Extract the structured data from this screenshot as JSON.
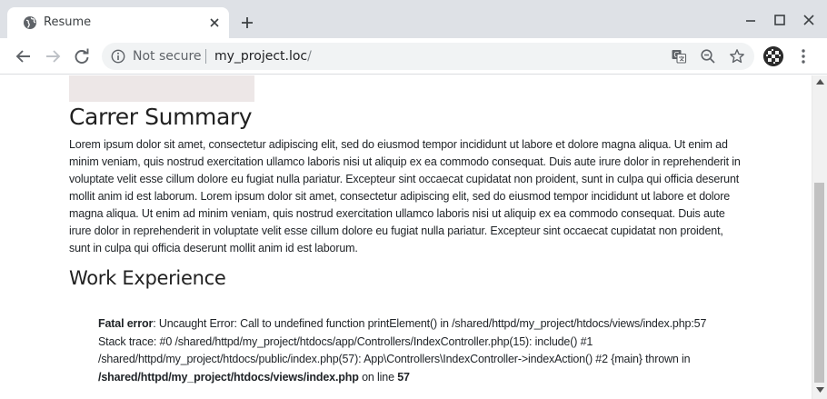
{
  "tab": {
    "title": "Resume",
    "favicon_icon": "globe-icon",
    "close_icon": "close-icon"
  },
  "toolbar": {
    "back_icon": "arrow-left-icon",
    "forward_icon": "arrow-right-icon",
    "reload_icon": "reload-icon",
    "security_label": "Not secure",
    "url_host": "my_project.loc",
    "url_path": "/",
    "translate_icon": "translate-icon",
    "zoom_icon": "zoom-out-icon",
    "bookmark_icon": "star-icon",
    "menu_icon": "more-vert-icon"
  },
  "page": {
    "summary_heading": "Carrer Summary",
    "summary_text": "Lorem ipsum dolor sit amet, consectetur adipiscing elit, sed do eiusmod tempor incididunt ut labore et dolore magna aliqua. Ut enim ad minim veniam, quis nostrud exercitation ullamco laboris nisi ut aliquip ex ea commodo consequat. Duis aute irure dolor in reprehenderit in voluptate velit esse cillum dolore eu fugiat nulla pariatur. Excepteur sint occaecat cupidatat non proident, sunt in culpa qui officia deserunt mollit anim id est laborum. Lorem ipsum dolor sit amet, consectetur adipiscing elit, sed do eiusmod tempor incididunt ut labore et dolore magna aliqua. Ut enim ad minim veniam, quis nostrud exercitation ullamco laboris nisi ut aliquip ex ea commodo consequat. Duis aute irure dolor in reprehenderit in voluptate velit esse cillum dolore eu fugiat nulla pariatur. Excepteur sint occaecat cupidatat non proident, sunt in culpa qui officia deserunt mollit anim id est laborum.",
    "work_heading": "Work Experience",
    "error": {
      "label": "Fatal error",
      "message": ": Uncaught Error: Call to undefined function printElement() in /shared/httpd/my_project/htdocs/views/index.php:57",
      "trace_1": "Stack trace: #0 /shared/httpd/my_project/htdocs/app/Controllers/IndexController.php(15): include() #1",
      "trace_2": "/shared/httpd/my_project/htdocs/public/index.php(57): App\\Controllers\\IndexController->indexAction() #2 {main} thrown in",
      "file": "/shared/httpd/my_project/htdocs/views/index.php",
      "on_line_text": " on line ",
      "line": "57"
    }
  },
  "colors": {
    "tabstrip": "#dee1e6",
    "image_placeholder": "#ede7e7",
    "scroll_thumb": "#c1c1c1"
  }
}
